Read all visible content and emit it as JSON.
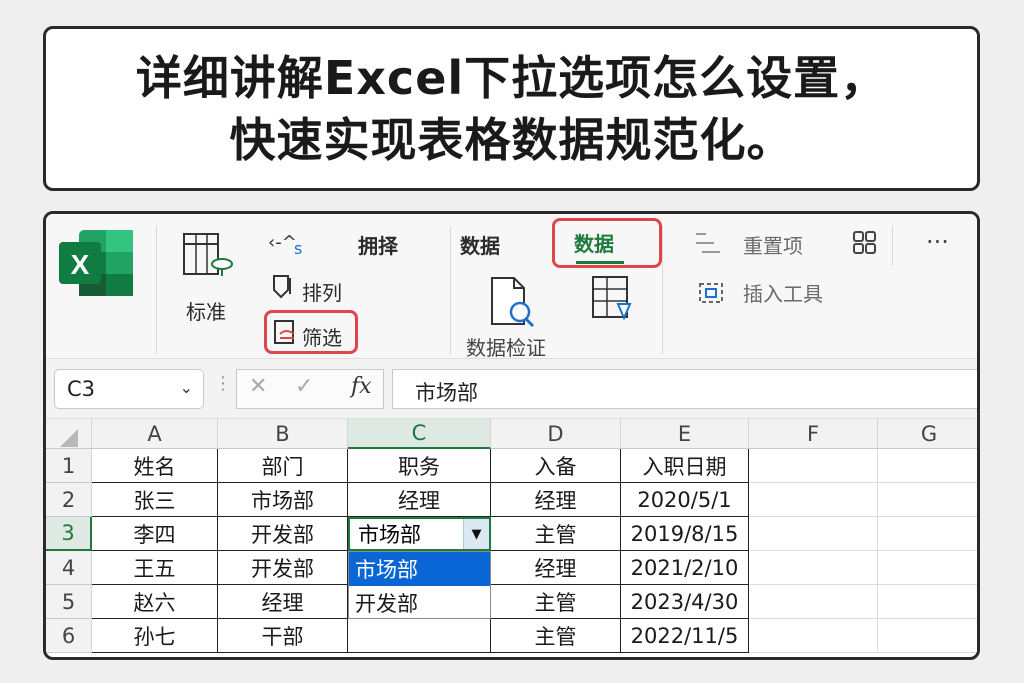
{
  "title": {
    "line1": "详细讲解Excel下拉选项怎么设置，",
    "line2": "快速实现表格数据规范化。"
  },
  "ribbon": {
    "logo_letter": "X",
    "standard_label": "标准",
    "sort_label": "排列",
    "filter_label": "筛选",
    "choose_label": "拥择",
    "data_label": "数据",
    "data_tab_label": "数据",
    "validation_label": "数据检证",
    "reset_label": "重置项",
    "insert_tool_label": "插入工具",
    "more_label": "···",
    "accent_color": "#1e7a3c",
    "highlight_color": "#e0454a"
  },
  "formula_bar": {
    "name_box": "C3",
    "fx_label": "fx",
    "formula_value": "市场部"
  },
  "grid": {
    "columns": [
      "A",
      "B",
      "C",
      "D",
      "E",
      "F",
      "G"
    ],
    "row_numbers": [
      "1",
      "2",
      "3",
      "4",
      "5",
      "6"
    ],
    "rows": [
      [
        "姓名",
        "部门",
        "职务",
        "入备",
        "入职日期"
      ],
      [
        "张三",
        "市场部",
        "经理",
        "经理",
        "2020/5/1"
      ],
      [
        "李四",
        "开发部",
        "市场部",
        "主管",
        "2019/8/15"
      ],
      [
        "王五",
        "开发部",
        "",
        "经理",
        "2021/2/10"
      ],
      [
        "赵六",
        "经理",
        "",
        "主管",
        "2023/4/30"
      ],
      [
        "孙七",
        "干部",
        "",
        "主管",
        "2022/11/5"
      ]
    ],
    "active_cell": "C3",
    "dropdown_options": [
      "市场部",
      "开发部"
    ],
    "dropdown_selected": "市场部"
  }
}
